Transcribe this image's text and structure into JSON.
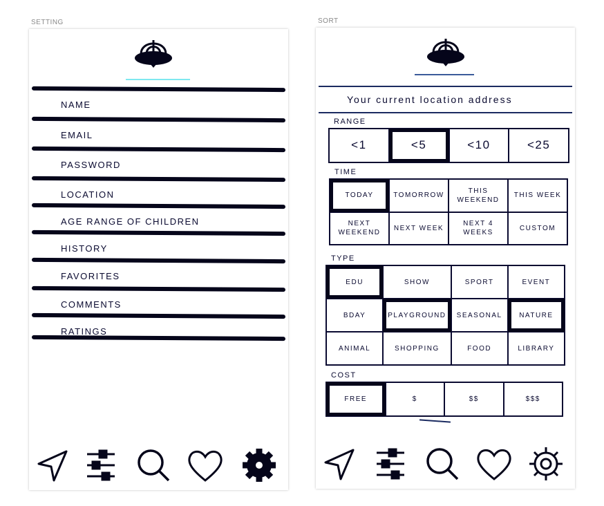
{
  "setting": {
    "caption": "SETTING",
    "items": [
      "Name",
      "Email",
      "Password",
      "Location",
      "Age range of children",
      "History",
      "Favorites",
      "Comments",
      "Ratings"
    ],
    "nav": [
      {
        "icon": "navigation-arrow-icon"
      },
      {
        "icon": "sliders-icon"
      },
      {
        "icon": "search-icon"
      },
      {
        "icon": "heart-icon"
      },
      {
        "icon": "gear-icon",
        "active": true
      }
    ]
  },
  "sort": {
    "caption": "SORT",
    "location_text": "Your current location address",
    "range": {
      "label": "Range",
      "options": [
        "<1",
        "<5",
        "<10",
        "<25"
      ],
      "selected": 1
    },
    "time": {
      "label": "Time",
      "options": [
        "Today",
        "Tomorrow",
        "This weekend",
        "This week",
        "Next weekend",
        "Next week",
        "Next 4 weeks",
        "Custom"
      ],
      "selected": [
        0
      ]
    },
    "type": {
      "label": "Type",
      "options": [
        "Edu",
        "Show",
        "Sport",
        "Event",
        "BDay",
        "Playground",
        "Seasonal",
        "Nature",
        "Animal",
        "Shopping",
        "Food",
        "Library"
      ],
      "selected": [
        0,
        5,
        7
      ]
    },
    "cost": {
      "label": "Cost",
      "options": [
        "Free",
        "$",
        "$$",
        "$$$"
      ],
      "selected": [
        0
      ]
    },
    "nav": [
      {
        "icon": "navigation-arrow-icon"
      },
      {
        "icon": "sliders-icon"
      },
      {
        "icon": "search-icon"
      },
      {
        "icon": "heart-icon"
      },
      {
        "icon": "gear-icon",
        "active": false
      }
    ]
  },
  "colors": {
    "ink": "#05051a",
    "accent_line": "#7fe8f0"
  }
}
